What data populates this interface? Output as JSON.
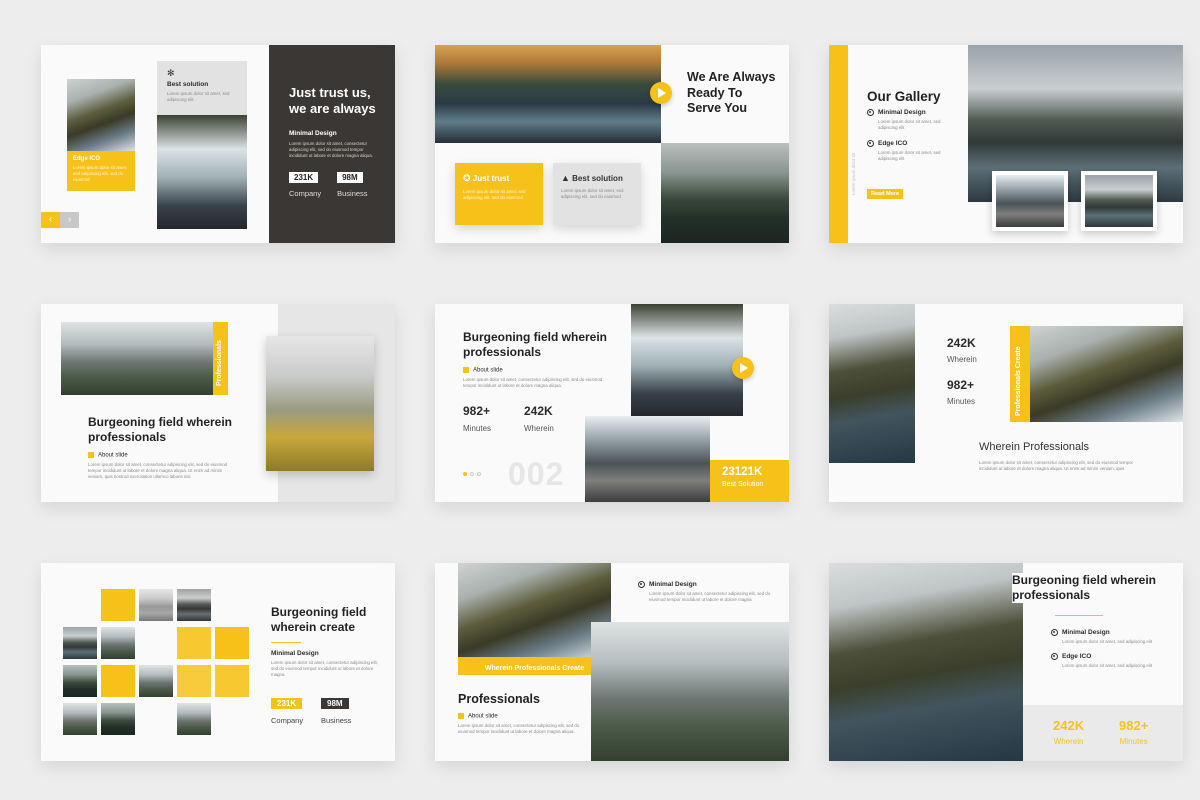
{
  "s1": {
    "best_solution": "Best solution",
    "edge_ico": "Edge ICO",
    "headline": "Just trust us, we are always",
    "minimal_design": "Minimal Design",
    "stat1_value": "231K",
    "stat1_label": "Company",
    "stat2_value": "98M",
    "stat2_label": "Business",
    "prev_arrow": "‹",
    "next_arrow": "›"
  },
  "s2": {
    "headline": "We Are Always Ready To Serve You",
    "card1_title": "Just trust",
    "card2_title": "Best solution"
  },
  "s3": {
    "title": "Our Gallery",
    "item1": "Minimal Design",
    "item2": "Edge ICO",
    "read_more": "Read More"
  },
  "s4": {
    "vertical_tag": "Professionals",
    "title": "Burgeoning field wherein professionals",
    "about": "About slide"
  },
  "s5": {
    "title": "Burgeoning field wherein professionals",
    "about": "About slide",
    "stat1_value": "982+",
    "stat1_label": "Minutes",
    "stat2_value": "242K",
    "stat2_label": "Wherein",
    "big_number": "002",
    "box_value": "23121K",
    "box_label": "Best Solution"
  },
  "s6": {
    "stat1_value": "242K",
    "stat1_label": "Wherein",
    "stat2_value": "982+",
    "stat2_label": "Minutes",
    "vertical_tag": "Professionals Create",
    "subtitle": "Wherein Professionals"
  },
  "s7": {
    "title": "Burgeoning field wherein create",
    "minimal_design": "Minimal Design",
    "stat1_value": "231K",
    "stat1_label": "Company",
    "stat2_value": "98M",
    "stat2_label": "Business"
  },
  "s8": {
    "item": "Minimal Design",
    "banner": "Wherein Professionals Create",
    "title": "Professionals",
    "about": "About slide"
  },
  "s9": {
    "title": "Burgeoning field wherein professionals",
    "item1": "Minimal Design",
    "item2": "Edge ICO",
    "stat1_value": "242K",
    "stat1_label": "Wherein",
    "stat2_value": "982+",
    "stat2_label": "Minutes"
  },
  "colors": {
    "accent": "#f6c21a",
    "dark_panel": "#3b3734",
    "background": "#ededed"
  }
}
